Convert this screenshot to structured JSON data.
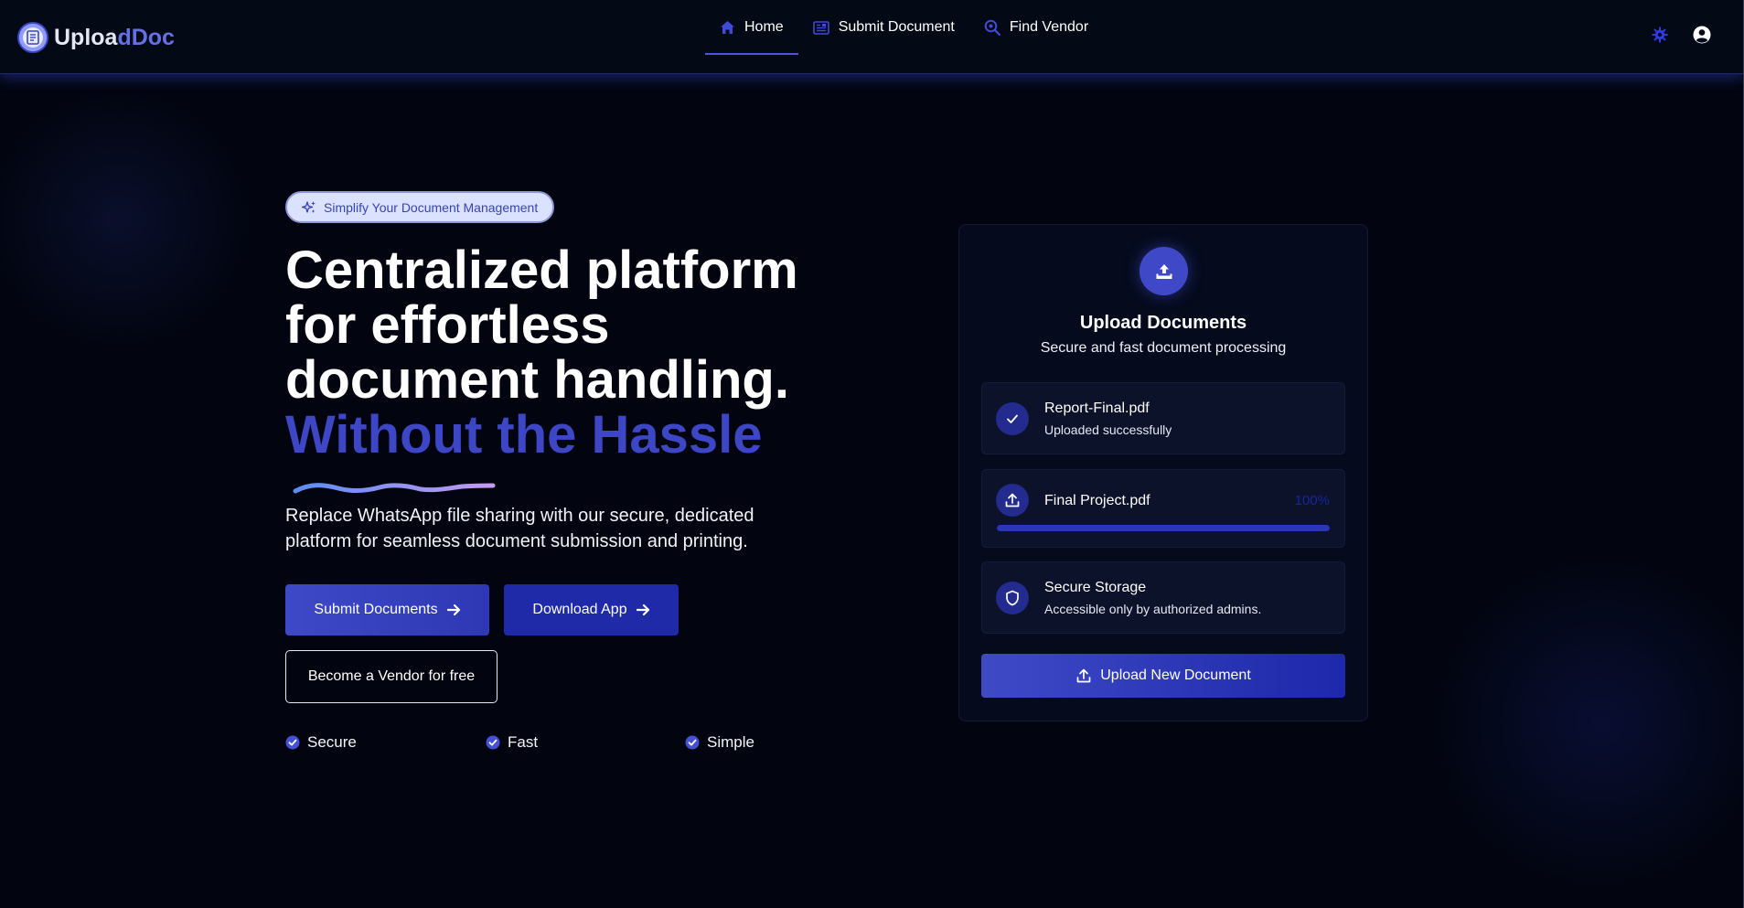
{
  "navbar": {
    "logo_part1": "Uploa",
    "logo_part2": "dDoc",
    "links": [
      {
        "label": "Home",
        "icon": "home-icon",
        "active": true
      },
      {
        "label": "Submit Document",
        "icon": "document-icon",
        "active": false
      },
      {
        "label": "Find Vendor",
        "icon": "search-icon",
        "active": false
      }
    ],
    "right_icons": [
      "gear-icon",
      "user-circle-icon"
    ]
  },
  "hero": {
    "pill_label": "Simplify Your Document Management",
    "headline_line1": "Centralized platform",
    "headline_line2": "for effortless",
    "headline_line3": "document handling.",
    "headline_accent": "Without the Hassle",
    "subtext": "Replace WhatsApp file sharing with our secure, dedicated platform for seamless document submission and printing.",
    "buttons": {
      "submit": "Submit Documents",
      "download": "Download App",
      "vendor": "Become a Vendor for free"
    },
    "features": [
      "Secure",
      "Fast",
      "Simple"
    ]
  },
  "upload_card": {
    "title": "Upload Documents",
    "subtitle": "Secure and fast document processing",
    "files": [
      {
        "name": "Report-Final.pdf",
        "status": "Uploaded successfully",
        "icon": "check-icon"
      },
      {
        "name": "Final Project.pdf",
        "progress_label": "100%",
        "progress": 1.0,
        "icon": "upload-icon"
      },
      {
        "name": "Secure Storage",
        "status": "Accessible only by authorized admins.",
        "icon": "shield-icon"
      }
    ],
    "button_label": "Upload New Document"
  },
  "colors": {
    "background": "#020510",
    "accent": "#3d46c4",
    "button_primary": "#1f2aa8",
    "pill_bg": "#dbe2ff"
  }
}
